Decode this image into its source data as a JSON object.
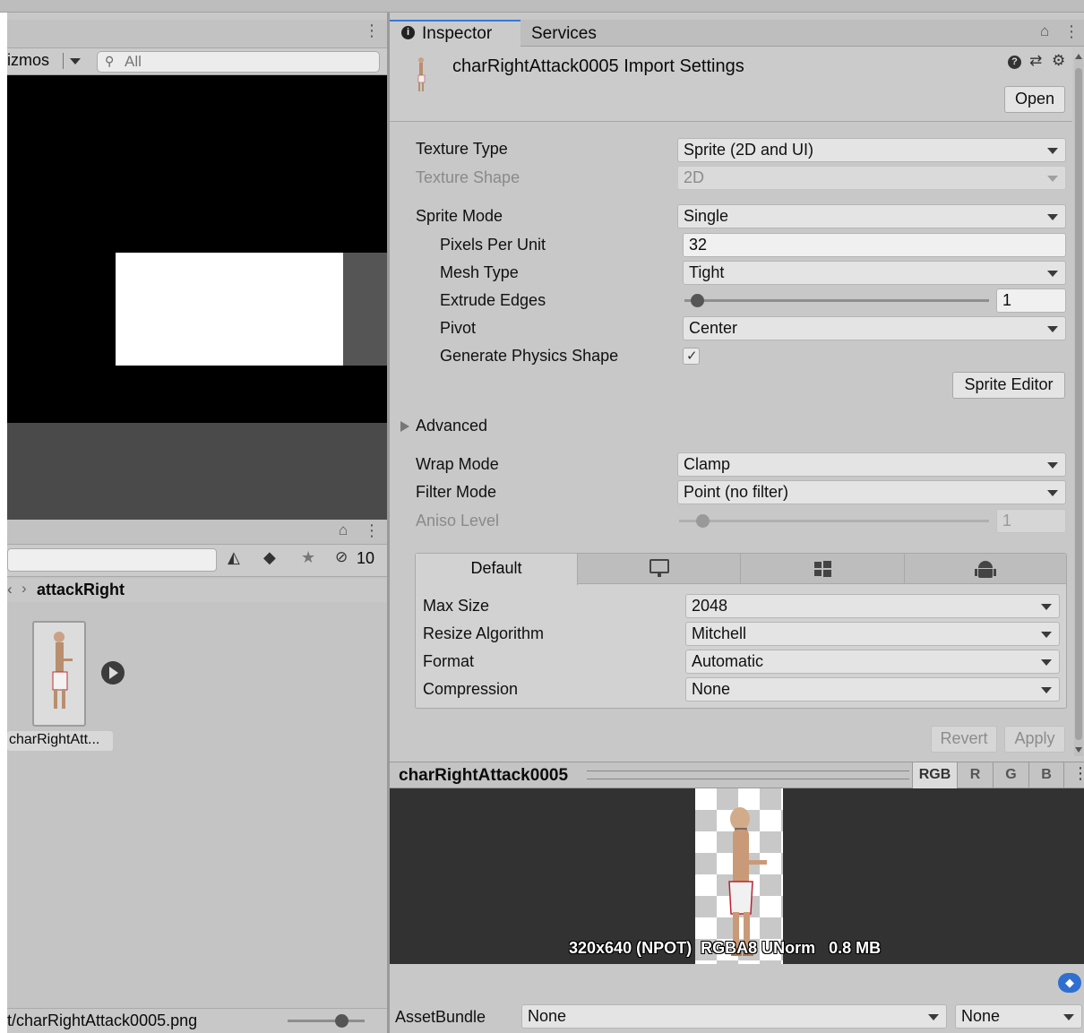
{
  "scene": {
    "gizmos_label": "izmos",
    "search_placeholder": "All"
  },
  "project": {
    "breadcrumb_prefix": "‹",
    "breadcrumb_current": "attackRight",
    "hidden_count": "10",
    "asset_label": "charRightAtt...",
    "status_path": "t/charRightAttack0005.png"
  },
  "inspector": {
    "tabs": [
      "Inspector",
      "Services"
    ],
    "title": "charRightAttack0005 Import Settings",
    "open_label": "Open",
    "texture_type_label": "Texture Type",
    "texture_type_value": "Sprite (2D and UI)",
    "texture_shape_label": "Texture Shape",
    "texture_shape_value": "2D",
    "sprite_mode_label": "Sprite Mode",
    "sprite_mode_value": "Single",
    "ppu_label": "Pixels Per Unit",
    "ppu_value": "32",
    "mesh_type_label": "Mesh Type",
    "mesh_type_value": "Tight",
    "extrude_label": "Extrude Edges",
    "extrude_value": "1",
    "pivot_label": "Pivot",
    "pivot_value": "Center",
    "physics_label": "Generate Physics Shape",
    "physics_checked": true,
    "sprite_editor_label": "Sprite Editor",
    "advanced_label": "Advanced",
    "wrap_label": "Wrap Mode",
    "wrap_value": "Clamp",
    "filter_label": "Filter Mode",
    "filter_value": "Point (no filter)",
    "aniso_label": "Aniso Level",
    "aniso_value": "1",
    "platform_tab_default": "Default",
    "max_size_label": "Max Size",
    "max_size_value": "2048",
    "resize_label": "Resize Algorithm",
    "resize_value": "Mitchell",
    "format_label": "Format",
    "format_value": "Automatic",
    "compression_label": "Compression",
    "compression_value": "None",
    "revert_label": "Revert",
    "apply_label": "Apply"
  },
  "preview": {
    "title": "charRightAttack0005",
    "channels": [
      "RGB",
      "R",
      "G",
      "B"
    ],
    "info": "320x640 (NPOT)  RGBA8 UNorm   0.8 MB"
  },
  "assetbundle": {
    "label": "AssetBundle",
    "name_value": "None",
    "variant_value": "None"
  }
}
